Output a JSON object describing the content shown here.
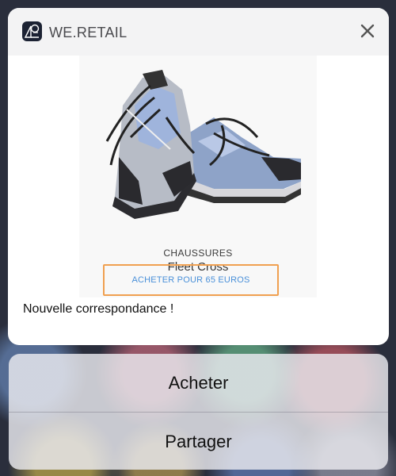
{
  "app": {
    "name": "WE.RETAIL",
    "icon": "we-retail-logo-icon"
  },
  "notification": {
    "close_icon": "close-icon",
    "product": {
      "category": "CHAUSSURES",
      "name": "Fleet Cross",
      "buy_label": "ACHETER POUR 65 EUROS",
      "image": "running-shoes-image"
    },
    "message": "Nouvelle correspondance !"
  },
  "actions": [
    {
      "label": "Acheter"
    },
    {
      "label": "Partager"
    }
  ],
  "colors": {
    "link": "#4a90d9",
    "highlight_border": "#f0a050"
  }
}
